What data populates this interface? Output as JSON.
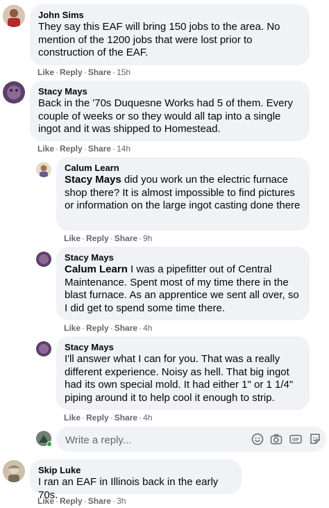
{
  "comments": [
    {
      "name": "John Sims",
      "text": "They say this EAF will bring 150 jobs to the area. No mention of the 1200 jobs that were lost prior to construction of the EAF.",
      "like": "Like",
      "reply": "Reply",
      "share": "Share",
      "time": "15h"
    },
    {
      "name": "Stacy Mays",
      "text": "Back in the '70s Duquesne Works had 5 of them. Every couple of weeks or so they would all tap into a single ingot and it was shipped to Homestead.",
      "like": "Like",
      "reply": "Reply",
      "share": "Share",
      "time": "14h"
    }
  ],
  "replies": [
    {
      "name": "Calum Learn",
      "mention": "Stacy Mays",
      "text": " did you work un the electric furnace shop there? It is almost impossible to find pictures or information on the large ingot casting done there",
      "like": "Like",
      "reply": "Reply",
      "share": "Share",
      "time": "9h"
    },
    {
      "name": "Stacy Mays",
      "mention": "Calum Learn",
      "text": " I was a pipefitter out of Central Maintenance. Spent most of my time there in the blast furnace. As an apprentice we sent all over, so I did get to spend some time there.",
      "like": "Like",
      "reply": "Reply",
      "share": "Share",
      "time": "4h"
    },
    {
      "name": "Stacy Mays",
      "text": "I'll answer what I can for you. That was a really different experience. Noisy as hell. That big ingot had its own special mold. It had either 1\" or 1 1/4\" piping around it to help cool it enough to strip.",
      "like": "Like",
      "reply": "Reply",
      "share": "Share",
      "time": "4h"
    }
  ],
  "composer": {
    "placeholder": "Write a reply...",
    "icons": [
      "emoji-icon",
      "camera-icon",
      "gif-icon",
      "sticker-icon"
    ]
  },
  "last_comment": {
    "name": "Skip Luke",
    "text": "I ran an EAF in Illinois back in the early 70s.",
    "like": "Like",
    "reply": "Reply",
    "share": "Share",
    "time": "3h"
  },
  "colors": {
    "bubble": "#f0f2f5",
    "meta": "#65676b",
    "online": "#31a24c"
  }
}
